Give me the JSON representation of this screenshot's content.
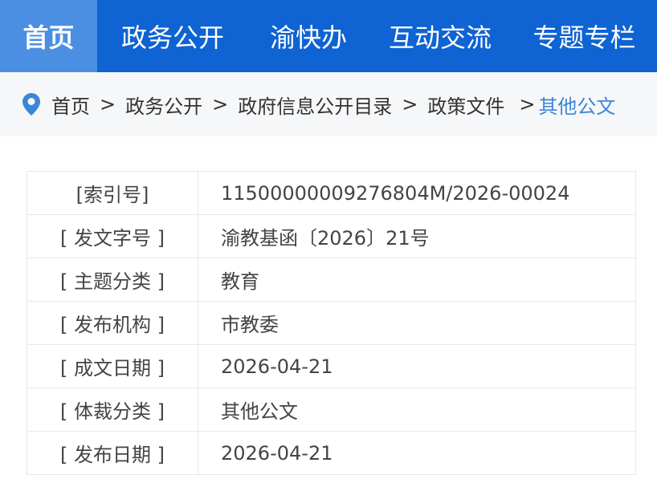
{
  "nav": {
    "items": [
      "首页",
      "政务公开",
      "渝快办",
      "互动交流",
      "专题专栏"
    ],
    "active_index": 0
  },
  "breadcrumb": {
    "items": [
      "首页",
      "政务公开",
      "政府信息公开目录",
      "政策文件"
    ],
    "current": "其他公文",
    "separator": ">",
    "icon": "location-pin-icon"
  },
  "info": {
    "rows": [
      {
        "label": "[索引号]",
        "value": "11500000009276804M/2026-00024"
      },
      {
        "label": "[ 发文字号 ]",
        "value": "渝教基函〔2026〕21号"
      },
      {
        "label": "[ 主题分类 ]",
        "value": "教育"
      },
      {
        "label": "[ 发布机构 ]",
        "value": "市教委"
      },
      {
        "label": "[ 成文日期 ]",
        "value": "2026-04-21"
      },
      {
        "label": "[ 体裁分类 ]",
        "value": "其他公文"
      },
      {
        "label": "[ 发布日期 ]",
        "value": "2026-04-21"
      }
    ]
  },
  "colors": {
    "nav_bg": "#0f63d2",
    "nav_active_bg": "#4a8fe2",
    "crumb_current": "#3a86d8",
    "pin": "#3a86d8"
  }
}
